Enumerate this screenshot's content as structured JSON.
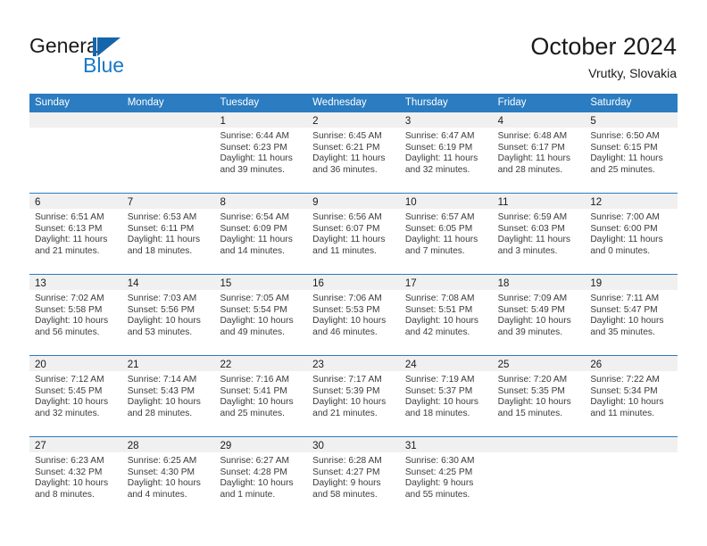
{
  "brand": {
    "name_part1": "General",
    "name_part2": "Blue",
    "logo_icon": "blue-flag-triangle-icon"
  },
  "header": {
    "title": "October 2024",
    "subtitle": "Vrutky, Slovakia"
  },
  "colors": {
    "header_blue": "#2b7cc0",
    "brand_blue": "#1878c8",
    "logo_blue": "#1565ab",
    "daynum_band": "#f0f0f0",
    "text": "#3b3b3b"
  },
  "calendar": {
    "weekday_headers": [
      "Sunday",
      "Monday",
      "Tuesday",
      "Wednesday",
      "Thursday",
      "Friday",
      "Saturday"
    ],
    "weeks": [
      [
        {
          "day": "",
          "empty": true
        },
        {
          "day": "",
          "empty": true
        },
        {
          "day": "1",
          "sunrise": "Sunrise: 6:44 AM",
          "sunset": "Sunset: 6:23 PM",
          "daylight": "Daylight: 11 hours and 39 minutes."
        },
        {
          "day": "2",
          "sunrise": "Sunrise: 6:45 AM",
          "sunset": "Sunset: 6:21 PM",
          "daylight": "Daylight: 11 hours and 36 minutes."
        },
        {
          "day": "3",
          "sunrise": "Sunrise: 6:47 AM",
          "sunset": "Sunset: 6:19 PM",
          "daylight": "Daylight: 11 hours and 32 minutes."
        },
        {
          "day": "4",
          "sunrise": "Sunrise: 6:48 AM",
          "sunset": "Sunset: 6:17 PM",
          "daylight": "Daylight: 11 hours and 28 minutes."
        },
        {
          "day": "5",
          "sunrise": "Sunrise: 6:50 AM",
          "sunset": "Sunset: 6:15 PM",
          "daylight": "Daylight: 11 hours and 25 minutes."
        }
      ],
      [
        {
          "day": "6",
          "sunrise": "Sunrise: 6:51 AM",
          "sunset": "Sunset: 6:13 PM",
          "daylight": "Daylight: 11 hours and 21 minutes."
        },
        {
          "day": "7",
          "sunrise": "Sunrise: 6:53 AM",
          "sunset": "Sunset: 6:11 PM",
          "daylight": "Daylight: 11 hours and 18 minutes."
        },
        {
          "day": "8",
          "sunrise": "Sunrise: 6:54 AM",
          "sunset": "Sunset: 6:09 PM",
          "daylight": "Daylight: 11 hours and 14 minutes."
        },
        {
          "day": "9",
          "sunrise": "Sunrise: 6:56 AM",
          "sunset": "Sunset: 6:07 PM",
          "daylight": "Daylight: 11 hours and 11 minutes."
        },
        {
          "day": "10",
          "sunrise": "Sunrise: 6:57 AM",
          "sunset": "Sunset: 6:05 PM",
          "daylight": "Daylight: 11 hours and 7 minutes."
        },
        {
          "day": "11",
          "sunrise": "Sunrise: 6:59 AM",
          "sunset": "Sunset: 6:03 PM",
          "daylight": "Daylight: 11 hours and 3 minutes."
        },
        {
          "day": "12",
          "sunrise": "Sunrise: 7:00 AM",
          "sunset": "Sunset: 6:00 PM",
          "daylight": "Daylight: 11 hours and 0 minutes."
        }
      ],
      [
        {
          "day": "13",
          "sunrise": "Sunrise: 7:02 AM",
          "sunset": "Sunset: 5:58 PM",
          "daylight": "Daylight: 10 hours and 56 minutes."
        },
        {
          "day": "14",
          "sunrise": "Sunrise: 7:03 AM",
          "sunset": "Sunset: 5:56 PM",
          "daylight": "Daylight: 10 hours and 53 minutes."
        },
        {
          "day": "15",
          "sunrise": "Sunrise: 7:05 AM",
          "sunset": "Sunset: 5:54 PM",
          "daylight": "Daylight: 10 hours and 49 minutes."
        },
        {
          "day": "16",
          "sunrise": "Sunrise: 7:06 AM",
          "sunset": "Sunset: 5:53 PM",
          "daylight": "Daylight: 10 hours and 46 minutes."
        },
        {
          "day": "17",
          "sunrise": "Sunrise: 7:08 AM",
          "sunset": "Sunset: 5:51 PM",
          "daylight": "Daylight: 10 hours and 42 minutes."
        },
        {
          "day": "18",
          "sunrise": "Sunrise: 7:09 AM",
          "sunset": "Sunset: 5:49 PM",
          "daylight": "Daylight: 10 hours and 39 minutes."
        },
        {
          "day": "19",
          "sunrise": "Sunrise: 7:11 AM",
          "sunset": "Sunset: 5:47 PM",
          "daylight": "Daylight: 10 hours and 35 minutes."
        }
      ],
      [
        {
          "day": "20",
          "sunrise": "Sunrise: 7:12 AM",
          "sunset": "Sunset: 5:45 PM",
          "daylight": "Daylight: 10 hours and 32 minutes."
        },
        {
          "day": "21",
          "sunrise": "Sunrise: 7:14 AM",
          "sunset": "Sunset: 5:43 PM",
          "daylight": "Daylight: 10 hours and 28 minutes."
        },
        {
          "day": "22",
          "sunrise": "Sunrise: 7:16 AM",
          "sunset": "Sunset: 5:41 PM",
          "daylight": "Daylight: 10 hours and 25 minutes."
        },
        {
          "day": "23",
          "sunrise": "Sunrise: 7:17 AM",
          "sunset": "Sunset: 5:39 PM",
          "daylight": "Daylight: 10 hours and 21 minutes."
        },
        {
          "day": "24",
          "sunrise": "Sunrise: 7:19 AM",
          "sunset": "Sunset: 5:37 PM",
          "daylight": "Daylight: 10 hours and 18 minutes."
        },
        {
          "day": "25",
          "sunrise": "Sunrise: 7:20 AM",
          "sunset": "Sunset: 5:35 PM",
          "daylight": "Daylight: 10 hours and 15 minutes."
        },
        {
          "day": "26",
          "sunrise": "Sunrise: 7:22 AM",
          "sunset": "Sunset: 5:34 PM",
          "daylight": "Daylight: 10 hours and 11 minutes."
        }
      ],
      [
        {
          "day": "27",
          "sunrise": "Sunrise: 6:23 AM",
          "sunset": "Sunset: 4:32 PM",
          "daylight": "Daylight: 10 hours and 8 minutes."
        },
        {
          "day": "28",
          "sunrise": "Sunrise: 6:25 AM",
          "sunset": "Sunset: 4:30 PM",
          "daylight": "Daylight: 10 hours and 4 minutes."
        },
        {
          "day": "29",
          "sunrise": "Sunrise: 6:27 AM",
          "sunset": "Sunset: 4:28 PM",
          "daylight": "Daylight: 10 hours and 1 minute."
        },
        {
          "day": "30",
          "sunrise": "Sunrise: 6:28 AM",
          "sunset": "Sunset: 4:27 PM",
          "daylight": "Daylight: 9 hours and 58 minutes."
        },
        {
          "day": "31",
          "sunrise": "Sunrise: 6:30 AM",
          "sunset": "Sunset: 4:25 PM",
          "daylight": "Daylight: 9 hours and 55 minutes."
        },
        {
          "day": "",
          "empty": true
        },
        {
          "day": "",
          "empty": true
        }
      ]
    ]
  }
}
